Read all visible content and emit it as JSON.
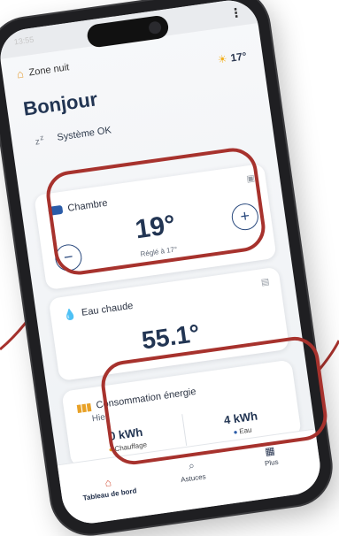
{
  "status": {
    "time": "13:55"
  },
  "header": {
    "zone_label": "Zone nuit",
    "weather_temp": "17°"
  },
  "greeting": "Bonjour",
  "system_status": "Système OK",
  "chambre": {
    "title": "Chambre",
    "temperature": "19°",
    "setpoint": "Réglé à 17°",
    "minus_label": "−",
    "plus_label": "+"
  },
  "eau_chaude": {
    "title": "Eau chaude",
    "temperature": "55.1°"
  },
  "consommation": {
    "title": "Consommation énergie",
    "period": "Hier",
    "heating_value": "0 kWh",
    "heating_label": "Chauffage",
    "water_value": "4 kWh",
    "water_label": "Eau"
  },
  "tabs": {
    "dashboard": "Tableau de bord",
    "tips": "Astuces",
    "more": "Plus"
  },
  "colors": {
    "highlight": "#a7322d",
    "heading": "#223553",
    "accent_blue": "#2b5ca8"
  },
  "icons": {
    "zone": "home-icon",
    "weather": "sun-cloud-icon",
    "system": "sleep-icon",
    "chambre": "bed-icon",
    "eau": "water-drop-icon",
    "conso": "bar-chart-icon",
    "dashboard_tab": "home-icon",
    "tips_tab": "search-icon",
    "more_tab": "grid-icon"
  }
}
